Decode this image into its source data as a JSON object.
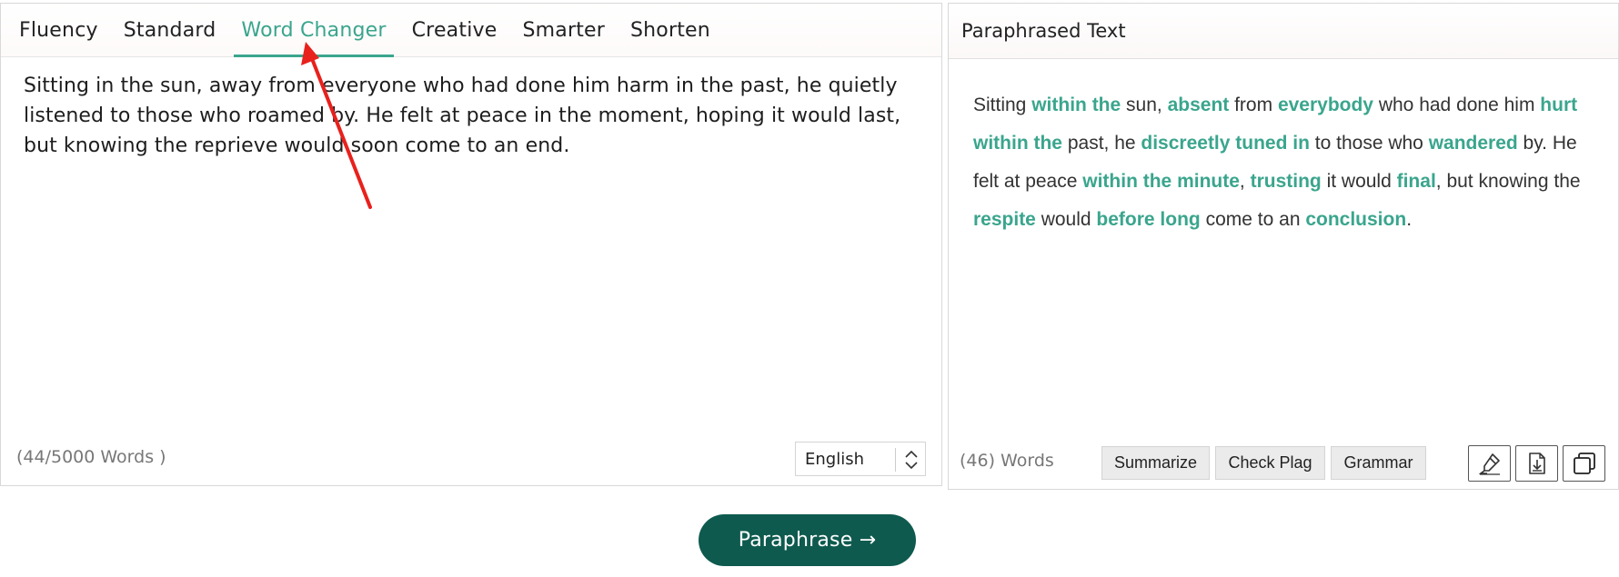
{
  "modes": {
    "tabs": [
      {
        "label": "Fluency"
      },
      {
        "label": "Standard"
      },
      {
        "label": "Word Changer"
      },
      {
        "label": "Creative"
      },
      {
        "label": "Smarter"
      },
      {
        "label": "Shorten"
      }
    ],
    "active": "Word Changer"
  },
  "input": {
    "text": "Sitting in the sun, away from everyone who had done him harm in the past, he quietly listened to those who roamed by. He felt at peace in the moment, hoping it would last, but knowing the reprieve would soon come to an end.",
    "word_count": "(44/5000 Words )",
    "language": "English"
  },
  "output": {
    "title": "Paraphrased Text",
    "segments": [
      {
        "text": "Sitting ",
        "changed": false
      },
      {
        "text": "within the",
        "changed": true
      },
      {
        "text": " sun, ",
        "changed": false
      },
      {
        "text": "absent",
        "changed": true
      },
      {
        "text": " from ",
        "changed": false
      },
      {
        "text": "everybody",
        "changed": true
      },
      {
        "text": " who had done him ",
        "changed": false
      },
      {
        "text": "hurt within the",
        "changed": true
      },
      {
        "text": " past, he ",
        "changed": false
      },
      {
        "text": "discreetly tuned in",
        "changed": true
      },
      {
        "text": " to those who ",
        "changed": false
      },
      {
        "text": "wandered",
        "changed": true
      },
      {
        "text": " by. He felt at peace ",
        "changed": false
      },
      {
        "text": "within the minute",
        "changed": true
      },
      {
        "text": ", ",
        "changed": false
      },
      {
        "text": "trusting",
        "changed": true
      },
      {
        "text": " it would ",
        "changed": false
      },
      {
        "text": "final",
        "changed": true
      },
      {
        "text": ", but knowing the ",
        "changed": false
      },
      {
        "text": "respite",
        "changed": true
      },
      {
        "text": " would ",
        "changed": false
      },
      {
        "text": "before long",
        "changed": true
      },
      {
        "text": " come to an ",
        "changed": false
      },
      {
        "text": "conclusion",
        "changed": true
      },
      {
        "text": ".",
        "changed": false
      }
    ],
    "word_count": "(46) Words",
    "actions": [
      "Summarize",
      "Check Plag",
      "Grammar"
    ],
    "icons": [
      "highlighter-icon",
      "download-icon",
      "copy-icon"
    ]
  },
  "paraphrase_button": "Paraphrase →",
  "colors": {
    "accent": "#3aa58d",
    "button": "#0e5a4e",
    "annotation_arrow": "#e8211d"
  }
}
